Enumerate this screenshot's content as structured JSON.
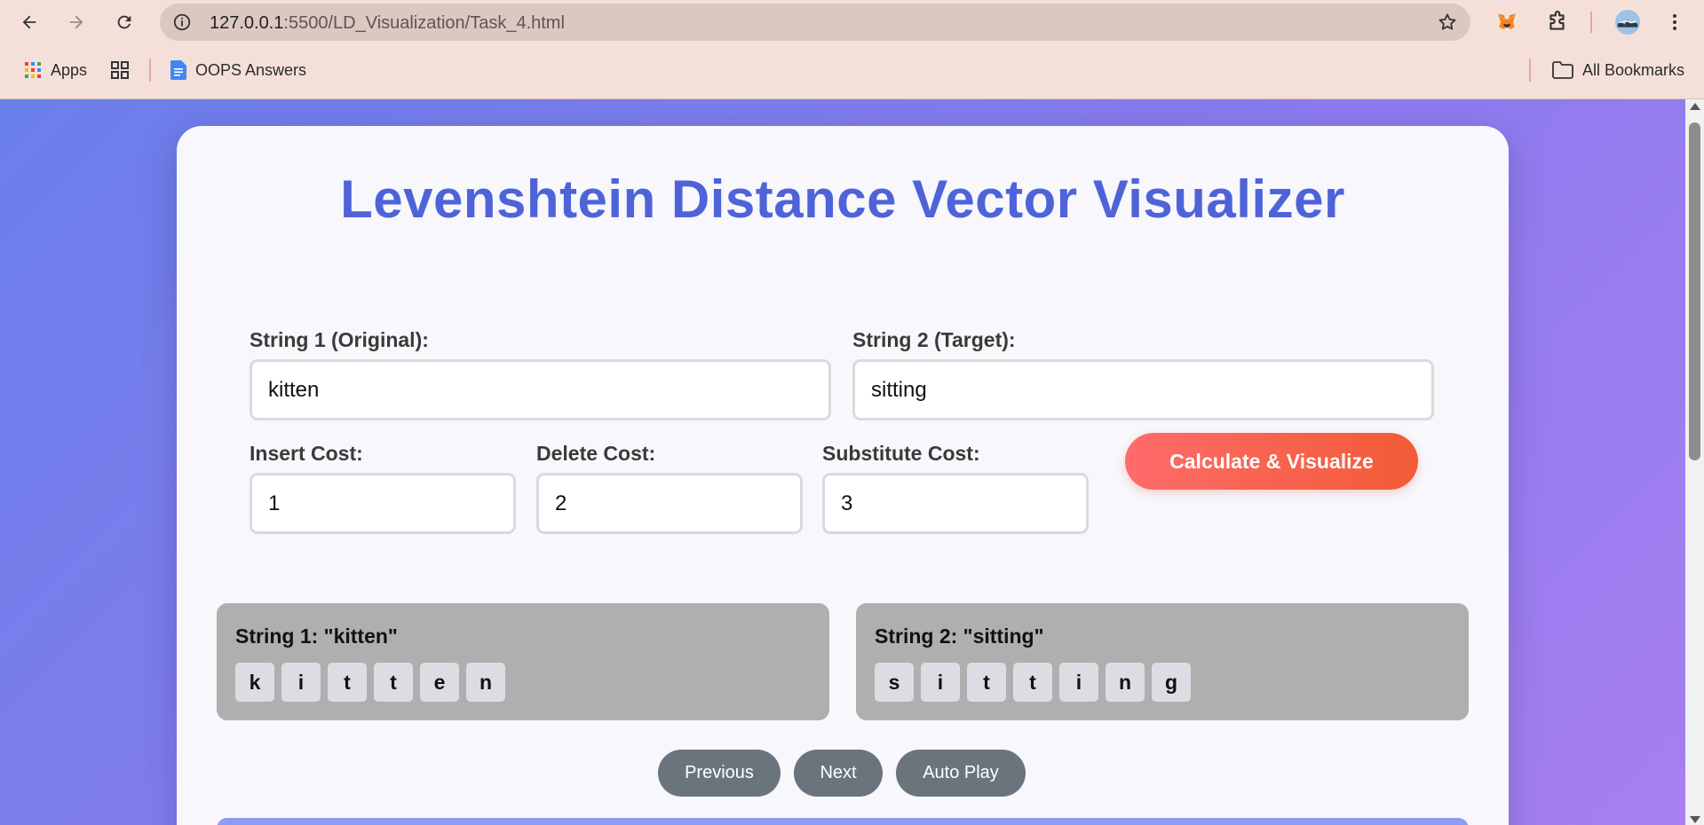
{
  "browser": {
    "url_host": "127.0.0.1",
    "url_path": ":5500/LD_Visualization/Task_4.html",
    "bookmarks": {
      "apps_label": "Apps",
      "oops_label": "OOPS Answers",
      "all_label": "All Bookmarks"
    }
  },
  "page": {
    "title": "Levenshtein Distance Vector Visualizer",
    "string1_label": "String 1 (Original):",
    "string1_value": "kitten",
    "string2_label": "String 2 (Target):",
    "string2_value": "sitting",
    "insert_label": "Insert Cost:",
    "insert_value": "1",
    "delete_label": "Delete Cost:",
    "delete_value": "2",
    "substitute_label": "Substitute Cost:",
    "substitute_value": "3",
    "calculate_label": "Calculate & Visualize",
    "panel1_title": "String 1: \"kitten\"",
    "panel1_chars": [
      "k",
      "i",
      "t",
      "t",
      "e",
      "n"
    ],
    "panel2_title": "String 2: \"sitting\"",
    "panel2_chars": [
      "s",
      "i",
      "t",
      "t",
      "i",
      "n",
      "g"
    ],
    "previous_label": "Previous",
    "next_label": "Next",
    "autoplay_label": "Auto Play"
  }
}
